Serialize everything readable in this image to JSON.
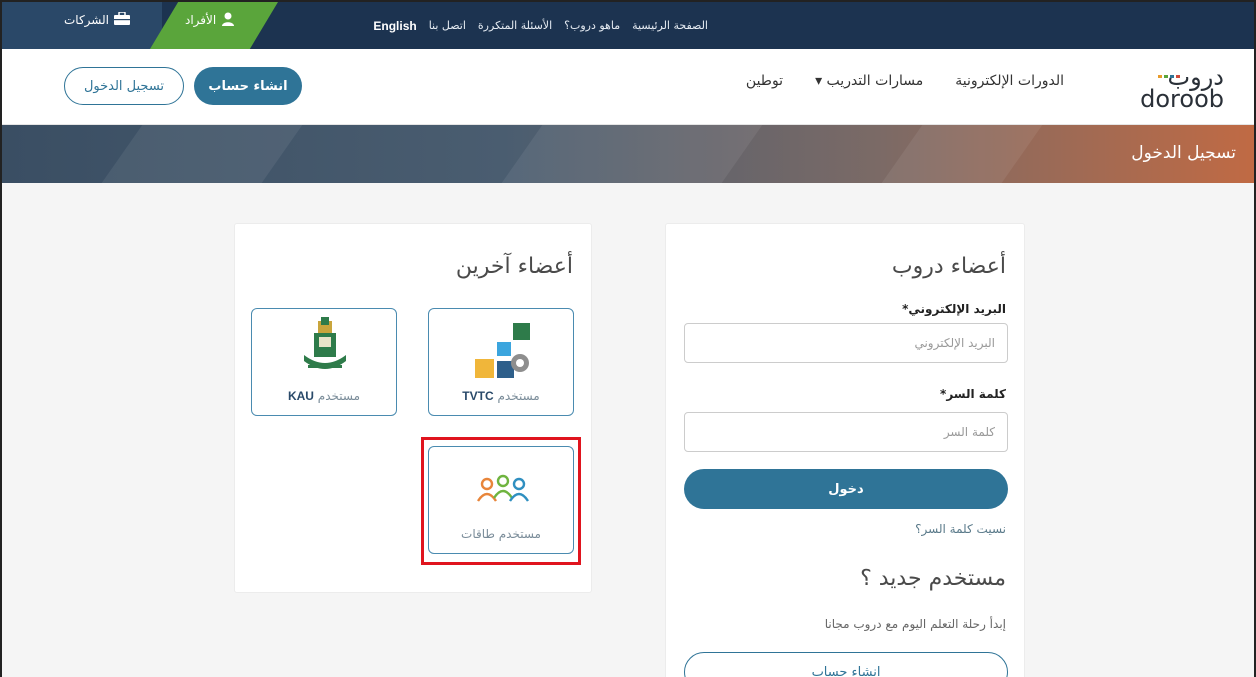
{
  "topbar": {
    "links": [
      "الصفحة الرئيسية",
      "ماهو دروب؟",
      "الأسئلة المتكررة",
      "اتصل بنا",
      "English"
    ],
    "individuals_label": "الأفراد",
    "companies_label": "الشركات",
    "colors": {
      "bar": "#1c3350",
      "individuals": "#5aa53b",
      "companies": "#2a4868"
    }
  },
  "header": {
    "logo_ar": "دروب",
    "logo_en": "doroob",
    "nav": [
      "الدورات الإلكترونية",
      "مسارات التدريب ▾",
      "توطين"
    ],
    "signup_button": "انشاء حساب",
    "login_button": "تسجيل الدخول",
    "accent": "#2f7497"
  },
  "banner": {
    "title": "تسجيل الدخول"
  },
  "login_form": {
    "title": "أعضاء دروب",
    "email_label": "البريد الإلكتروني*",
    "email_placeholder": "البريد الإلكتروني",
    "password_label": "كلمة السر*",
    "password_placeholder": "كلمة السر",
    "submit": "دخول",
    "forgot": "نسيت كلمة السر؟",
    "new_user_title": "مستخدم جديد ؟",
    "new_user_text": "إبدأ رحلة التعلم اليوم مع دروب مجانا",
    "signup": "انشاء حساب"
  },
  "other_members": {
    "title": "أعضاء آخرين",
    "tiles": [
      {
        "prefix": "مستخدم",
        "brand": "TVTC",
        "icon": "tvtc-logo-icon"
      },
      {
        "prefix": "مستخدم",
        "brand": "KAU",
        "icon": "kau-logo-icon"
      },
      {
        "prefix": "مستخدم طاقات",
        "brand": "",
        "icon": "taqat-people-icon"
      }
    ]
  }
}
